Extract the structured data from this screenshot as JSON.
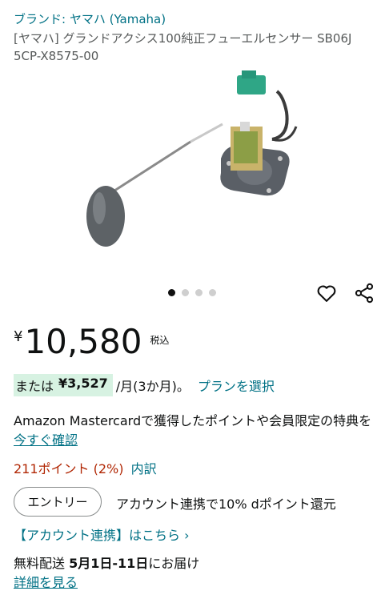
{
  "brand": "ブランド: ヤマハ (Yamaha)",
  "title": "[ヤマハ] グランドアクシス100純正フューエルセンサー SB06J 5CP-X8575-00",
  "gallery": {
    "dots": 4,
    "active_index": 0
  },
  "icons": {
    "favorite": "heart-icon",
    "share": "share-icon"
  },
  "price": {
    "currency": "¥",
    "amount": "10,580",
    "tax": "税込"
  },
  "installment": {
    "prefix": "または",
    "amount": "¥3,527",
    "period": "/月(3か月)。",
    "plan_link": "プランを選択"
  },
  "card_promo": {
    "text": "Amazon Mastercardで獲得したポイントや会員限定の特典を",
    "link": "今すぐ確認"
  },
  "points": {
    "value": "211ポイント (2%)",
    "breakdown": "内訳"
  },
  "entry": {
    "button": "エントリー",
    "text": "アカウント連携で10% dポイント還元"
  },
  "account_link": "【アカウント連携】はこちら ›",
  "delivery": {
    "prefix": "無料配送",
    "dates": "5月1日-11日",
    "suffix": "にお届け",
    "details_link": "詳細を見る"
  },
  "colors": {
    "link": "#007185",
    "price_red": "#b12704",
    "highlight": "#d7f2e2"
  }
}
